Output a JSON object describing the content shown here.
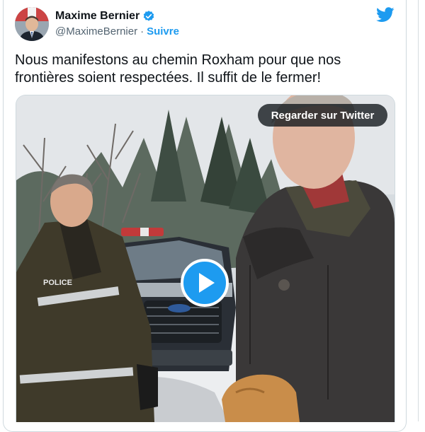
{
  "author": {
    "name": "Maxime Bernier",
    "handle": "@MaximeBernier",
    "separator": "·",
    "follow_label": "Suivre",
    "verified_icon": "verified-badge-icon",
    "avatar_icon": "avatar"
  },
  "brand": {
    "icon": "twitter-bird-icon",
    "color": "#1d9bf0"
  },
  "tweet": {
    "line1": "Nous manifestons au chemin Roxham pour que nos",
    "line2": "frontières soient respectées. Il suffit de le fermer!"
  },
  "media": {
    "watch_label": "Regarder sur Twitter",
    "play_icon": "play-icon",
    "vest_text": "POLICE"
  },
  "colors": {
    "text": "#0f1419",
    "secondary": "#536471",
    "accent": "#1d9bf0",
    "border": "#cfd9de"
  }
}
